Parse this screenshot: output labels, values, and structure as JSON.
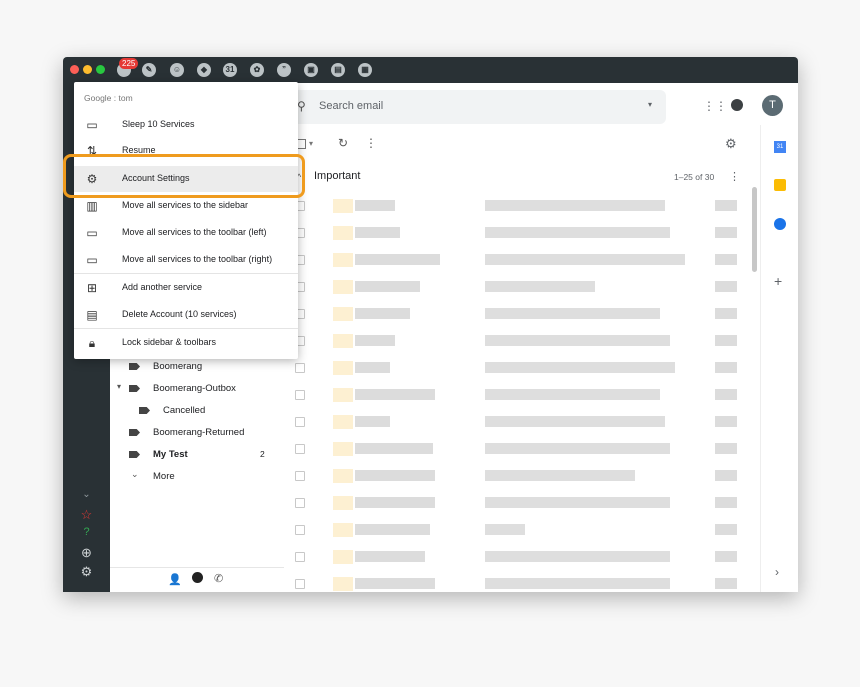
{
  "titlebar": {
    "notification_count": "225"
  },
  "menu": {
    "header": "Google : tom",
    "items": [
      {
        "label": "Sleep 10 Services",
        "icon": "sleep-icon"
      },
      {
        "label": "Resume",
        "icon": "resume-icon"
      },
      {
        "label": "Account Settings",
        "icon": "gear-icon"
      },
      {
        "label": "Move all services to the sidebar",
        "icon": "sidebar-icon"
      },
      {
        "label": "Move all services to the toolbar (left)",
        "icon": "toolbar-left-icon"
      },
      {
        "label": "Move all services to the toolbar (right)",
        "icon": "toolbar-right-icon"
      },
      {
        "label": "Add another service",
        "icon": "add-service-icon"
      },
      {
        "label": "Delete Account (10 services)",
        "icon": "delete-icon"
      },
      {
        "label": "Lock sidebar & toolbars",
        "icon": "lock-icon"
      }
    ]
  },
  "gmail": {
    "search_placeholder": "Search email",
    "section": "Important",
    "pagination": "1–25 of 30",
    "avatar": "T",
    "labels": [
      {
        "name": "Boomerang"
      },
      {
        "name": "Boomerang-Outbox"
      },
      {
        "name": "Cancelled"
      },
      {
        "name": "Boomerang-Returned"
      },
      {
        "name": "My Test",
        "count": "2"
      },
      {
        "name": "More"
      }
    ]
  },
  "colors": {
    "highlight": "#ef9b1e",
    "titlebar": "#293135",
    "badge": "#e53935"
  }
}
